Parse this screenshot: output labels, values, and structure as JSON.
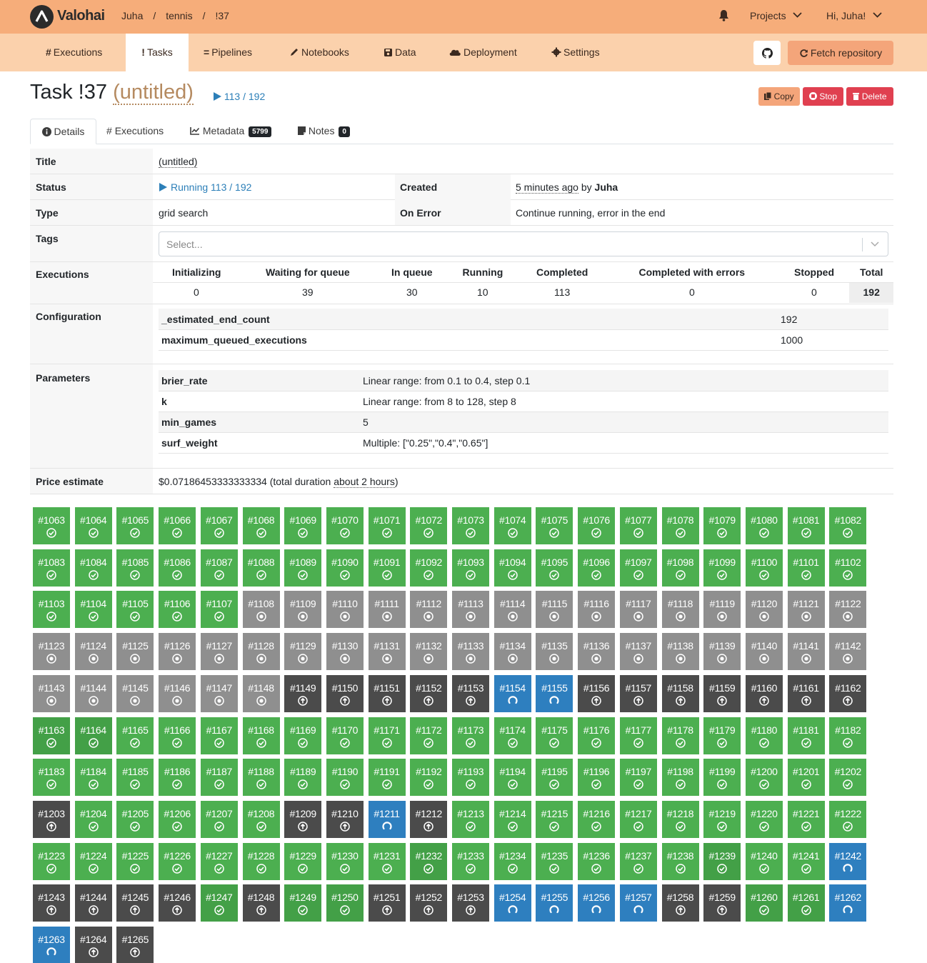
{
  "header": {
    "brand": "Valohai",
    "breadcrumb": [
      "Juha",
      "tennis",
      "!37"
    ],
    "projects_label": "Projects",
    "user_label": "Hi, Juha!"
  },
  "nav": {
    "executions": "Executions",
    "tasks": "Tasks",
    "pipelines": "Pipelines",
    "notebooks": "Notebooks",
    "data": "Data",
    "deployment": "Deployment",
    "settings": "Settings",
    "fetch_repository": "Fetch repository"
  },
  "task": {
    "title_prefix": "Task !37",
    "title_name": "(untitled)",
    "progress": "113 / 192",
    "copy": "Copy",
    "stop": "Stop",
    "delete": "Delete"
  },
  "tabs": {
    "details": "Details",
    "executions": "Executions",
    "metadata": "Metadata",
    "metadata_count": "5799",
    "notes": "Notes",
    "notes_count": "0"
  },
  "details": {
    "title_label": "Title",
    "title_value": "(untitled)",
    "status_label": "Status",
    "status_value": "Running 113 / 192",
    "created_label": "Created",
    "created_ago": "5 minutes ago",
    "created_by_word": "by",
    "created_by": "Juha",
    "type_label": "Type",
    "type_value": "grid search",
    "onerror_label": "On Error",
    "onerror_value": "Continue running, error in the end",
    "tags_label": "Tags",
    "tags_placeholder": "Select...",
    "executions_label": "Executions",
    "configuration_label": "Configuration",
    "parameters_label": "Parameters",
    "price_label": "Price estimate",
    "price_value": "$0.07186453333333334 (total duration",
    "price_duration": "about 2 hours",
    "price_close": ")"
  },
  "executions_summary": {
    "headers": [
      "Initializing",
      "Waiting for queue",
      "In queue",
      "Running",
      "Completed",
      "Completed with errors",
      "Stopped",
      "Total"
    ],
    "values": [
      "0",
      "39",
      "30",
      "10",
      "113",
      "0",
      "0",
      "192"
    ]
  },
  "configuration": [
    {
      "key": "_estimated_end_count",
      "value": "192"
    },
    {
      "key": "maximum_queued_executions",
      "value": "1000"
    }
  ],
  "parameters": [
    {
      "key": "brier_rate",
      "value": "Linear range: from 0.1 to 0.4, step 0.1"
    },
    {
      "key": "k",
      "value": "Linear range: from 8 to 128, step 8"
    },
    {
      "key": "min_games",
      "value": "5"
    },
    {
      "key": "surf_weight",
      "value": "Multiple: [\"0.25\",\"0.4\",\"0.65\"]"
    }
  ],
  "status_colors": {
    "completed": "#4caf50",
    "completed_dark": "#43a047",
    "queued": "#8f8f8f",
    "waiting": "#4b4b4b",
    "running": "#2e7fbf"
  },
  "executions_grid": {
    "first": 1063,
    "status_codes": "DDDDDDDDDDDDDDDDDDDDDDDDDDDDDDDDDDDDDDDDDDDDDQQQQQQQQQQQQQQQQQQQQQQQQQQQQQQQQQQQQQQQQQWWWWWRRWWWWWWWGGDDDDDDDDDDDDDDDDDDDDDDDDDDDDDDDDDDDDDDWDDDDDWWRWDDDDDDDDDDDDDDDDDDDGDDDDDDGDDRWWWWGWGGWWWRRRRWWGGRRWW",
    "status_legend": {
      "D": "completed",
      "G": "completed (darker shade)",
      "Q": "in queue",
      "W": "waiting",
      "R": "running"
    }
  }
}
